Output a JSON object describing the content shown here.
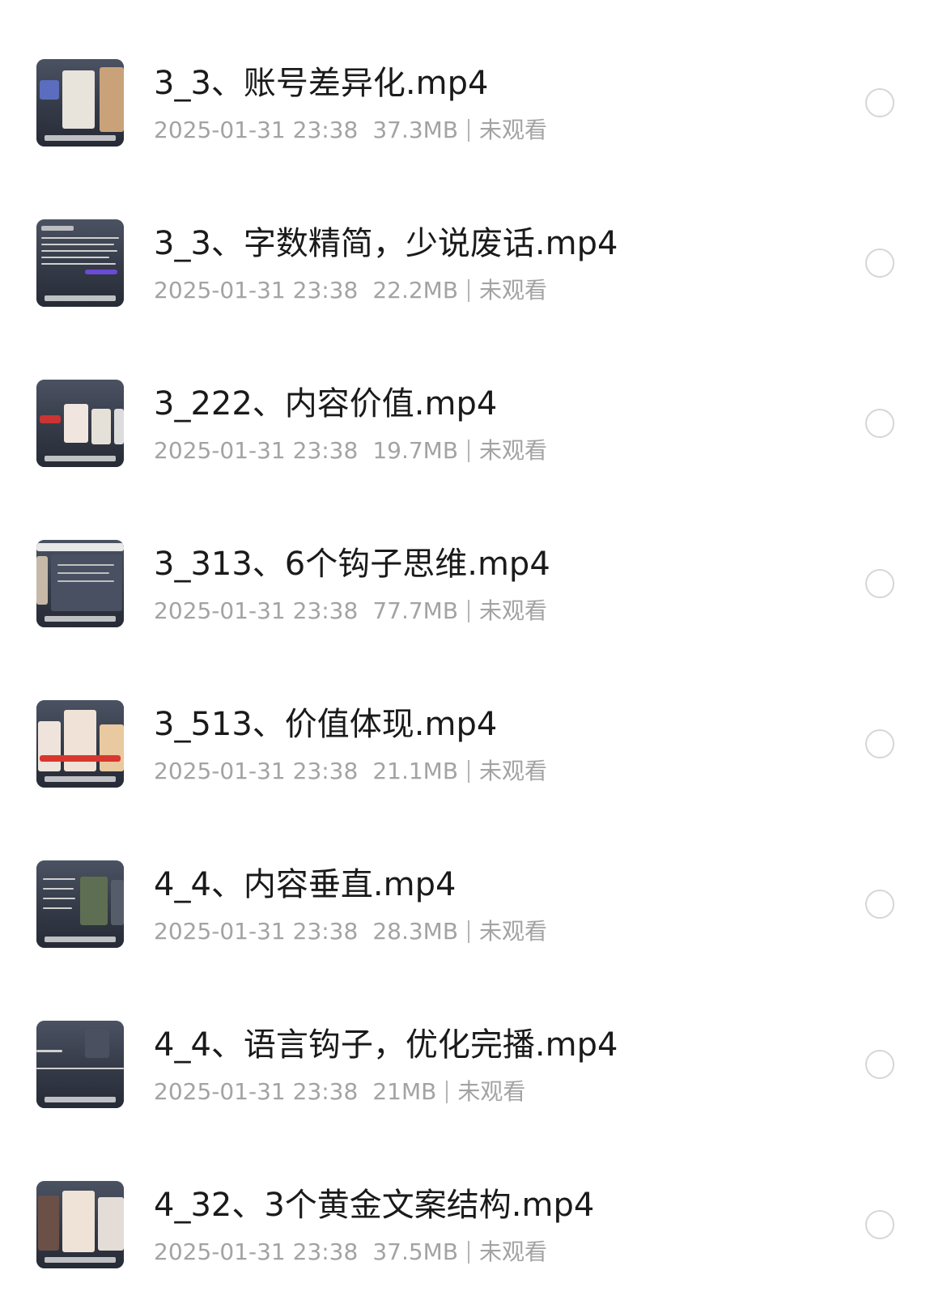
{
  "files": [
    {
      "title": "3_3、账号差异化.mp4",
      "date": "2025-01-31 23:38",
      "size": "37.3MB",
      "status": "未观看",
      "thumb_icon": "video-thumbnail-icon"
    },
    {
      "title": "3_3、字数精简，少说废话.mp4",
      "date": "2025-01-31 23:38",
      "size": "22.2MB",
      "status": "未观看",
      "thumb_icon": "video-thumbnail-icon"
    },
    {
      "title": "3_222、内容价值.mp4",
      "date": "2025-01-31 23:38",
      "size": "19.7MB",
      "status": "未观看",
      "thumb_icon": "video-thumbnail-icon"
    },
    {
      "title": "3_313、6个钩子思维.mp4",
      "date": "2025-01-31 23:38",
      "size": "77.7MB",
      "status": "未观看",
      "thumb_icon": "video-thumbnail-icon"
    },
    {
      "title": "3_513、价值体现.mp4",
      "date": "2025-01-31 23:38",
      "size": "21.1MB",
      "status": "未观看",
      "thumb_icon": "video-thumbnail-icon"
    },
    {
      "title": "4_4、内容垂直.mp4",
      "date": "2025-01-31 23:38",
      "size": "28.3MB",
      "status": "未观看",
      "thumb_icon": "video-thumbnail-icon"
    },
    {
      "title": "4_4、语言钩子，优化完播.mp4",
      "date": "2025-01-31 23:38",
      "size": "21MB",
      "status": "未观看",
      "thumb_icon": "video-thumbnail-icon"
    },
    {
      "title": "4_32、3个黄金文案结构.mp4",
      "date": "2025-01-31 23:38",
      "size": "37.5MB",
      "status": "未观看",
      "thumb_icon": "video-thumbnail-icon"
    }
  ],
  "colors": {
    "title": "#1a1a1a",
    "meta": "#a3a3a3",
    "radio_border": "#d6d6d6",
    "background": "#ffffff"
  }
}
